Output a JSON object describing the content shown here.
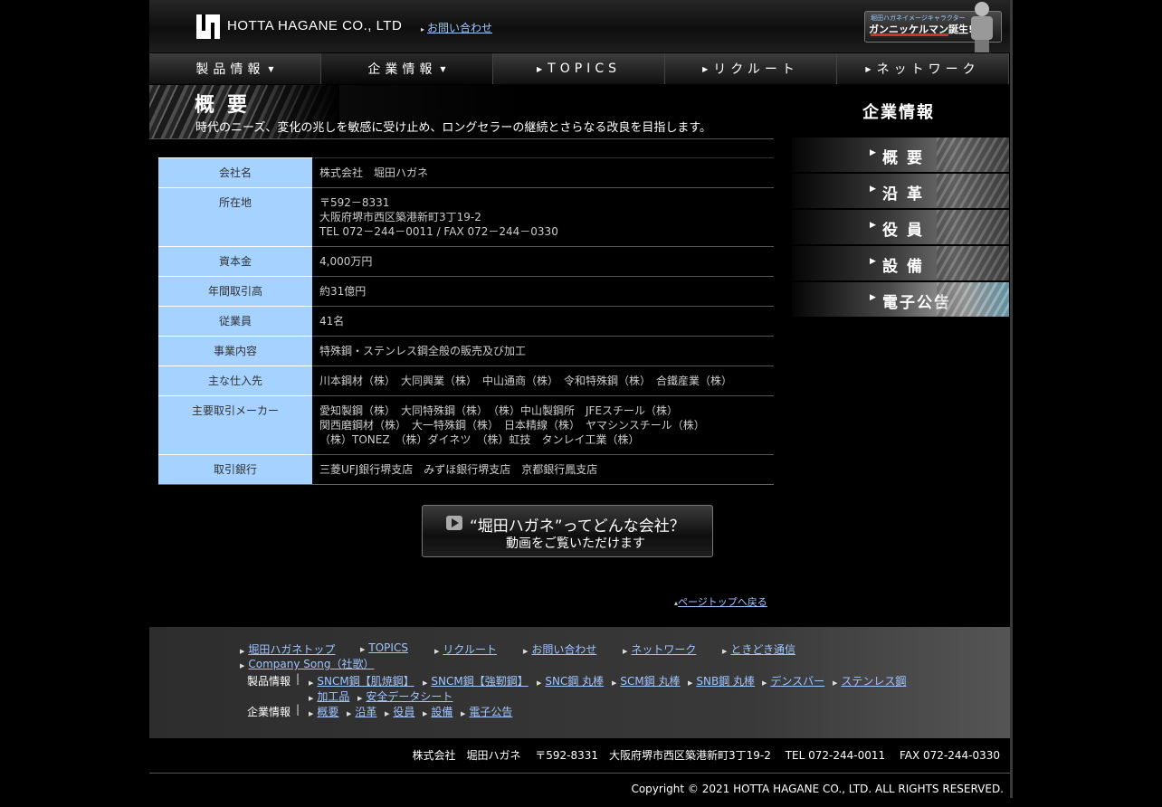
{
  "header": {
    "logo_text": "HOTTA HAGANE CO., LTD",
    "contact_link": "お問い合わせ",
    "banner_top": "堀田ハガネイメージキャラクター",
    "banner_main": "ガンニッケルマン誕生!"
  },
  "nav": [
    {
      "label": "製品情報"
    },
    {
      "label": "企業情報"
    },
    {
      "label": "TOPICS"
    },
    {
      "label": "リクルート"
    },
    {
      "label": "ネットワーク"
    }
  ],
  "page": {
    "heading": "概要",
    "subtitle": "時代のニーズ、変化の兆しを敏感に受け止め、ロングセラーの継続とさらなる改良を目指します。"
  },
  "company": {
    "rows": [
      {
        "label": "会社名",
        "value": "株式会社　堀田ハガネ"
      },
      {
        "label": "所在地",
        "lines": [
          "〒592－8331",
          "大阪府堺市西区築港新町3丁19-2",
          "TEL 072－244－0011 / FAX 072－244－0330"
        ]
      },
      {
        "label": "資本金",
        "value": "4,000万円"
      },
      {
        "label": "年間取引高",
        "value": "約31億円"
      },
      {
        "label": "従業員",
        "value": "41名"
      },
      {
        "label": "事業内容",
        "value": "特殊鋼・ステンレス鋼全般の販売及び加工"
      },
      {
        "label": "主な仕入先",
        "value": "川本鋼材（株）　大同興業（株）　中山通商（株）　令和特殊鋼（株）　合鐵産業（株）"
      },
      {
        "label": "主要取引メーカー",
        "lines": [
          "愛知製鋼（株）　大同特殊鋼（株）　（株）中山製鋼所　JFEスチール（株）",
          "関西磨鋼材（株）　大一特殊鋼（株）　日本精線（株）　ヤマシンスチール（株）",
          "（株）TONEZ　（株）ダイネツ　（株）虹技　タンレイ工業（株）"
        ]
      },
      {
        "label": "取引銀行",
        "value": "三菱UFJ銀行堺支店　みずほ銀行堺支店　京都銀行鳳支店"
      }
    ]
  },
  "video": {
    "line1": "“堀田ハガネ”ってどんな会社？",
    "line2": "動画をご覧いただけます"
  },
  "pagetop": "ページトップへ戻る",
  "sidebar": {
    "title": "企業情報",
    "items": [
      {
        "label": "概要"
      },
      {
        "label": "沿革"
      },
      {
        "label": "役員"
      },
      {
        "label": "設備"
      },
      {
        "label": "電子公告"
      }
    ]
  },
  "footer": {
    "top_links": [
      "堀田ハガネトップ",
      "TOPICS",
      "リクルート",
      "お問い合わせ",
      "ネットワーク",
      "ときどき通信",
      "Company Song（社歌）"
    ],
    "products_label": "製品情報",
    "products_links": [
      "SNCM鋼【肌焼鋼】",
      "SNCM鋼【強靭鋼】",
      "SNC鋼 丸棒",
      "SCM鋼 丸棒",
      "SNB鋼 丸棒",
      "デンスバー",
      "ステンレス鋼",
      "加工品",
      "安全データシート"
    ],
    "company_label": "企業情報",
    "company_links": [
      "概要",
      "沿革",
      "役員",
      "設備",
      "電子公告"
    ],
    "address": "株式会社　堀田ハガネ　 〒592-8331　大阪府堺市西区築港新町3丁19-2　 TEL 072-244-0011　 FAX 072-244-0330",
    "copyright": "Copyright © 2021 HOTTA HAGANE CO., LTD. ALL RIGHTS RESERVED."
  }
}
